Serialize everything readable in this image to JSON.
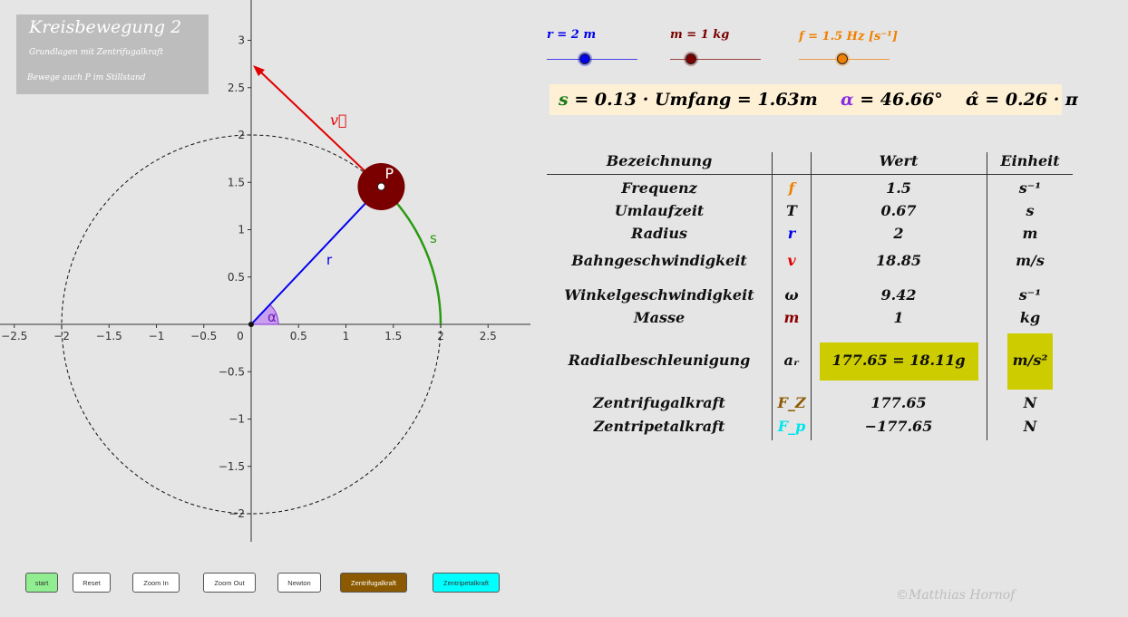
{
  "title": {
    "main": "Kreisbewegung 2",
    "sub1": "Grundlagen mit Zentrifugalkraft",
    "sub2": "Bewege auch P im Stillstand"
  },
  "graph": {
    "x_ticks": [
      "−2.5",
      "−2",
      "−1.5",
      "−1",
      "−0.5",
      "0",
      "0.5",
      "1",
      "1.5",
      "2",
      "2.5"
    ],
    "y_ticks": [
      "3",
      "2.5",
      "2",
      "1.5",
      "1",
      "0.5",
      "−0.5",
      "−1",
      "−1.5",
      "−2"
    ],
    "point_label": "P",
    "radius_label": "r",
    "arc_label": "s",
    "angle_label": "α",
    "velocity_label": "v⃗",
    "radius": 2,
    "angle_deg": 46.66
  },
  "sliders": [
    {
      "label": "r = 2 m",
      "color": "#0000ee",
      "value_fraction": 0.42
    },
    {
      "label": "m = 1 kg",
      "color": "#7a0000",
      "value_fraction": 0.23
    },
    {
      "label": "f = 1.5 Hz [s⁻¹]",
      "color": "#f08000",
      "value_fraction": 0.48
    }
  ],
  "formula": {
    "s_part": "s",
    "s_rest": " = 0.13 · Umfang = 1.63m",
    "alpha_part": "α",
    "alpha_rest": " = 46.66°",
    "alphahat": "α̂ = 0.26 · π"
  },
  "table": {
    "headers": {
      "name": "Bezeichnung",
      "value": "Wert",
      "unit": "Einheit"
    },
    "rows": [
      {
        "name": "Frequenz",
        "sym": "f",
        "symcolor": "#f08000",
        "value": "1.5",
        "unit": "s⁻¹"
      },
      {
        "name": "Umlaufzeit",
        "sym": "T",
        "symcolor": "#111111",
        "value": "0.67",
        "unit": "s"
      },
      {
        "name": "Radius",
        "sym": "r",
        "symcolor": "#0000ee",
        "value": "2",
        "unit": "m"
      },
      {
        "name": "Bahngeschwindigkeit",
        "sym": "v",
        "symcolor": "#e00000",
        "value": "18.85",
        "unit": "m/s"
      },
      {
        "name": "Winkelgeschwindigkeit",
        "sym": "ω",
        "symcolor": "#111111",
        "value": "9.42",
        "unit": "s⁻¹"
      },
      {
        "name": "Masse",
        "sym": "m",
        "symcolor": "#8b0000",
        "value": "1",
        "unit": "kg"
      },
      {
        "name": "Radialbeschleunigung",
        "sym": "aᵣ",
        "symcolor": "#111111",
        "value": "177.65 = 18.11g",
        "unit": "m/s²"
      },
      {
        "name": "Zentrifugalkraft",
        "sym": "F_Z",
        "symcolor": "#8b5a00",
        "value": "177.65",
        "unit": "N"
      },
      {
        "name": "Zentripetalkraft",
        "sym": "F_p",
        "symcolor": "#00e5ee",
        "value": "−177.65",
        "unit": "N"
      }
    ]
  },
  "buttons": [
    "start",
    "Reset",
    "Zoom  In",
    "Zoom Out",
    "Newton",
    "Zentrifugalkraft",
    "Zentripetalkraft"
  ],
  "copyright": "©Matthias Hornof"
}
